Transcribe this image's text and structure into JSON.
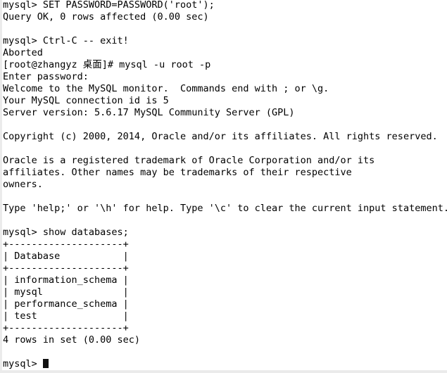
{
  "window": {
    "type": "terminal-emulator",
    "background_color": "#ffffff",
    "foreground_color": "#000000",
    "gutter_color": "#ebebeb",
    "cursor_color": "#101010"
  },
  "terminal": {
    "lines": [
      "mysql> SET PASSWORD=PASSWORD('root');",
      "Query OK, 0 rows affected (0.00 sec)",
      "",
      "mysql> Ctrl-C -- exit!",
      "Aborted",
      "[root@zhangyz 桌面]# mysql -u root -p",
      "Enter password:",
      "Welcome to the MySQL monitor.  Commands end with ; or \\g.",
      "Your MySQL connection id is 5",
      "Server version: 5.6.17 MySQL Community Server (GPL)",
      "",
      "Copyright (c) 2000, 2014, Oracle and/or its affiliates. All rights reserved.",
      "",
      "Oracle is a registered trademark of Oracle Corporation and/or its",
      "affiliates. Other names may be trademarks of their respective",
      "owners.",
      "",
      "Type 'help;' or '\\h' for help. Type '\\c' to clear the current input statement.",
      "",
      "mysql> show databases;",
      "+--------------------+",
      "| Database           |",
      "+--------------------+",
      "| information_schema |",
      "| mysql              |",
      "| performance_schema |",
      "| test               |",
      "+--------------------+",
      "4 rows in set (0.00 sec)",
      ""
    ],
    "final_prompt": "mysql> ",
    "cursor": "block"
  },
  "session": {
    "shell_prompt": "[root@zhangyz 桌面]#",
    "user": "root",
    "host": "zhangyz",
    "working_directory": "桌面",
    "command_run": "mysql -u root -p",
    "password_prompt": "Enter password:",
    "mysql_prompt": "mysql>"
  },
  "mysql_banner": {
    "welcome": "Welcome to the MySQL monitor.  Commands end with ; or \\g.",
    "connection_id": "5",
    "server_version": "5.6.17 MySQL Community Server (GPL)",
    "copyright": "Copyright (c) 2000, 2014, Oracle and/or its affiliates. All rights reserved.",
    "trademark_1": "Oracle is a registered trademark of Oracle Corporation and/or its",
    "trademark_2": "affiliates. Other names may be trademarks of their respective",
    "trademark_3": "owners.",
    "help_hint": "Type 'help;' or '\\h' for help. Type '\\c' to clear the current input statement."
  },
  "commands": {
    "set_password": "mysql> SET PASSWORD=PASSWORD('root');",
    "set_password_result": "Query OK, 0 rows affected (0.00 sec)",
    "interrupt": "mysql> Ctrl-C -- exit!",
    "interrupt_result": "Aborted",
    "show_databases": "mysql> show databases;"
  },
  "result_table": {
    "border": "+--------------------+",
    "header_row": "| Database           |",
    "rows": [
      "| information_schema |",
      "| mysql              |",
      "| performance_schema |",
      "| test               |"
    ],
    "columns": [
      "Database"
    ],
    "values": [
      "information_schema",
      "mysql",
      "performance_schema",
      "test"
    ],
    "footer": "4 rows in set (0.00 sec)",
    "row_count": 4,
    "elapsed": "0.00 sec"
  }
}
